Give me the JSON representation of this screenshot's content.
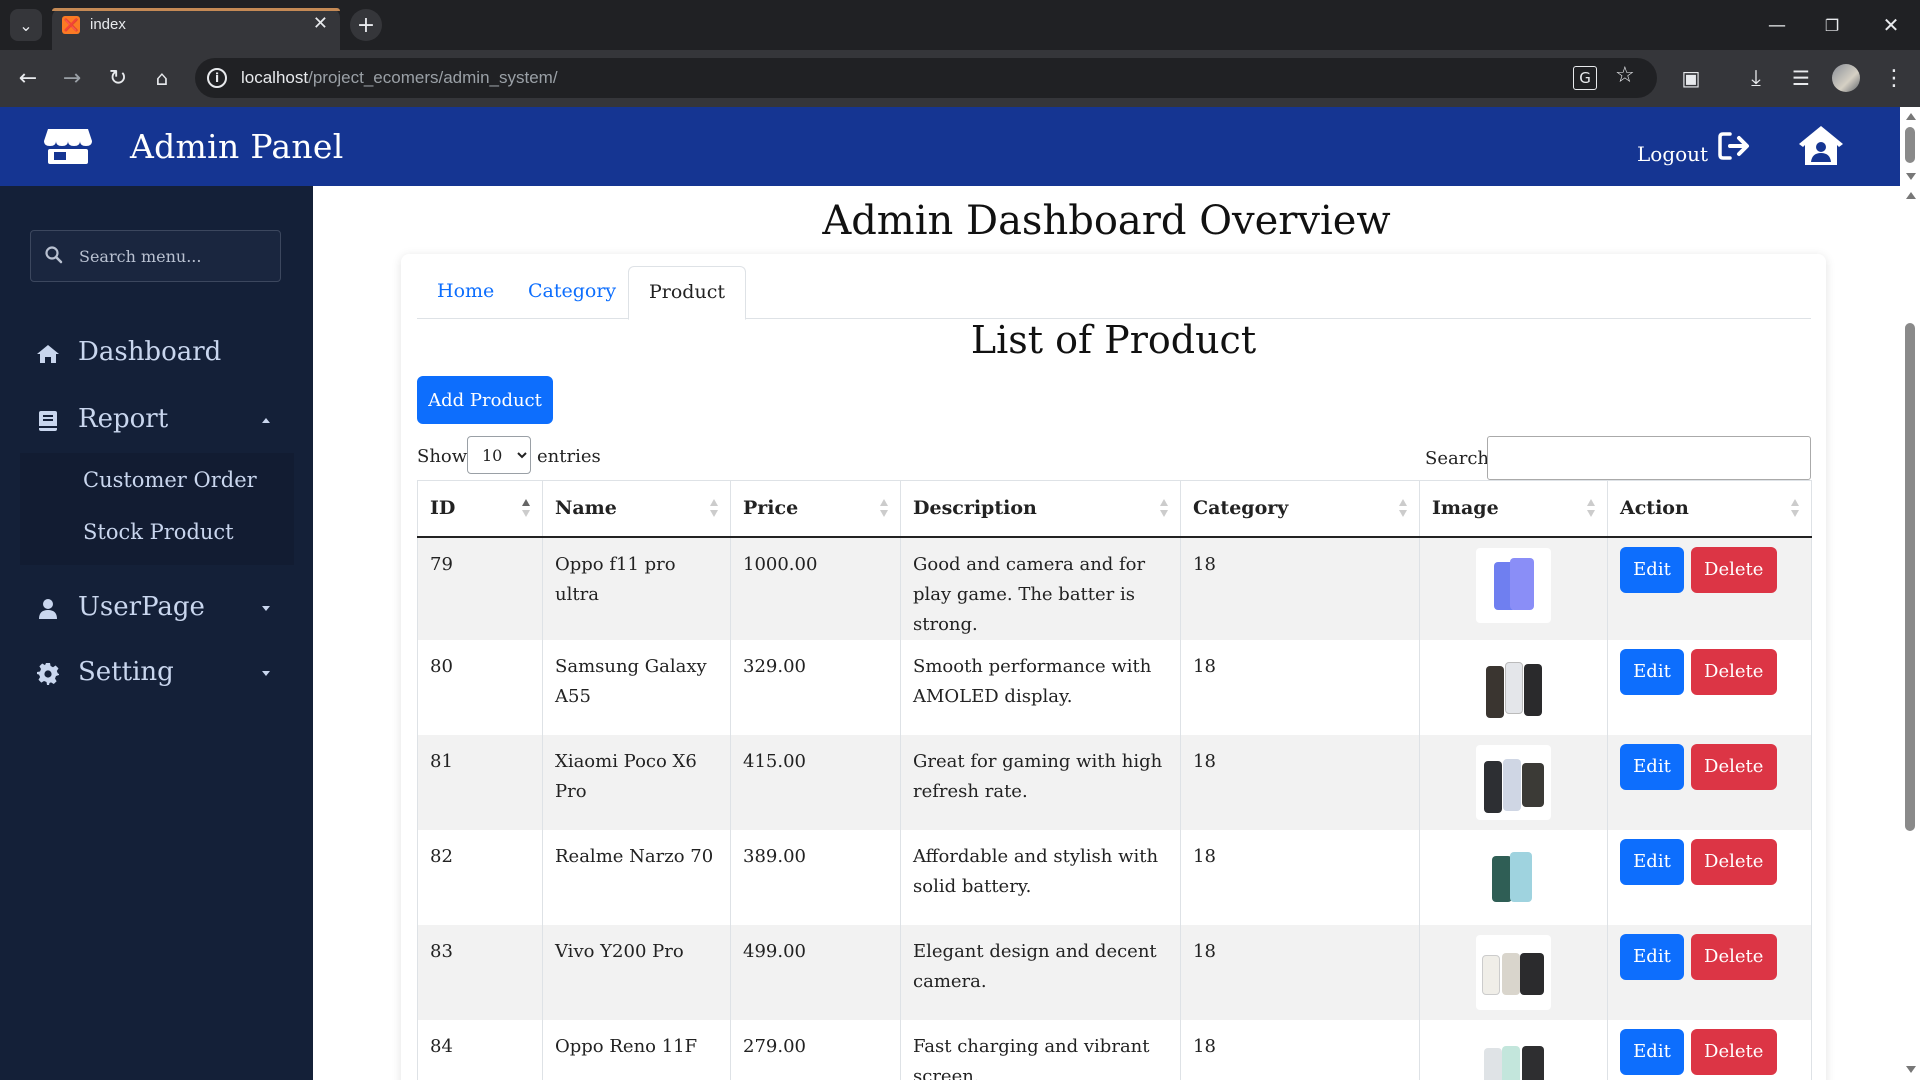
{
  "browser": {
    "tab_title": "index",
    "url_host": "localhost",
    "url_path": "/project_ecomers/admin_system/"
  },
  "topnav": {
    "brand": "Admin Panel",
    "logout": "Logout"
  },
  "sidebar": {
    "search_placeholder": "Search menu...",
    "items": [
      {
        "label": "Dashboard",
        "icon": "home-icon"
      },
      {
        "label": "Report",
        "icon": "book-icon",
        "expanded": true,
        "children": [
          "Customer Order",
          "Stock Product"
        ]
      },
      {
        "label": "UserPage",
        "icon": "user-icon"
      },
      {
        "label": "Setting",
        "icon": "gear-icon"
      }
    ]
  },
  "main": {
    "title": "Admin Dashboard Overview",
    "tabs": [
      {
        "label": "Home",
        "active": false
      },
      {
        "label": "Category",
        "active": false
      },
      {
        "label": "Product",
        "active": true
      }
    ],
    "list_title": "List of Product",
    "add_button": "Add Product",
    "show_label": "Show",
    "entries_value": "10",
    "entries_label": "entries",
    "search_label": "Search:",
    "edit_label": "Edit",
    "delete_label": "Delete"
  },
  "table": {
    "columns": [
      "ID",
      "Name",
      "Price",
      "Description",
      "Category",
      "Image",
      "Action"
    ],
    "rows": [
      {
        "id": "79",
        "name": "Oppo f11 pro ultra",
        "price": "1000.00",
        "description": "Good and camera and for play game. The batter is strong.",
        "category": "18"
      },
      {
        "id": "80",
        "name": "Samsung Galaxy A55",
        "price": "329.00",
        "description": "Smooth performance with AMOLED display.",
        "category": "18"
      },
      {
        "id": "81",
        "name": "Xiaomi Poco X6 Pro",
        "price": "415.00",
        "description": "Great for gaming with high refresh rate.",
        "category": "18"
      },
      {
        "id": "82",
        "name": "Realme Narzo 70",
        "price": "389.00",
        "description": "Affordable and stylish with solid battery.",
        "category": "18"
      },
      {
        "id": "83",
        "name": "Vivo Y200 Pro",
        "price": "499.00",
        "description": "Elegant design and decent camera.",
        "category": "18"
      },
      {
        "id": "84",
        "name": "Oppo Reno 11F",
        "price": "279.00",
        "description": "Fast charging and vibrant screen.",
        "category": "18"
      }
    ]
  },
  "colors": {
    "navbar": "#153592",
    "sidebar": "#142038",
    "primary": "#0d6efd",
    "danger": "#dc3545"
  }
}
